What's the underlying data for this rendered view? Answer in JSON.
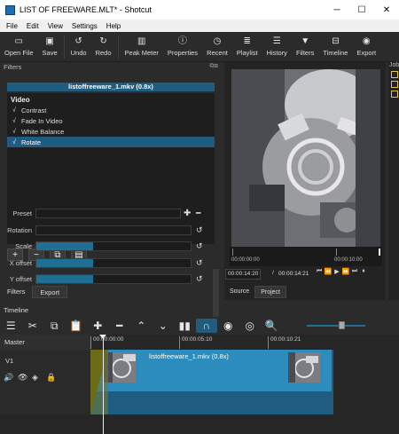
{
  "window": {
    "title": "LIST OF FREEWARE.MLT* - Shotcut",
    "minimize": "─",
    "maximize": "☐",
    "close": "✕"
  },
  "menu": [
    "File",
    "Edit",
    "View",
    "Settings",
    "Help"
  ],
  "toolbar": [
    {
      "label": "Open File",
      "icon": "folder-open-icon",
      "glyph": "▭"
    },
    {
      "label": "Save",
      "icon": "save-icon",
      "glyph": "▣"
    },
    {
      "label": "Undo",
      "icon": "undo-icon",
      "glyph": "↺"
    },
    {
      "label": "Redo",
      "icon": "redo-icon",
      "glyph": "↻"
    },
    {
      "label": "Peak Meter",
      "icon": "peak-meter-icon",
      "glyph": "▥"
    },
    {
      "label": "Properties",
      "icon": "properties-icon",
      "glyph": "ⓘ"
    },
    {
      "label": "Recent",
      "icon": "recent-icon",
      "glyph": "◷"
    },
    {
      "label": "Playlist",
      "icon": "playlist-icon",
      "glyph": "≣"
    },
    {
      "label": "History",
      "icon": "history-icon",
      "glyph": "☰"
    },
    {
      "label": "Filters",
      "icon": "filter-icon",
      "glyph": "▼"
    },
    {
      "label": "Timeline",
      "icon": "timeline-icon",
      "glyph": "⊟"
    },
    {
      "label": "Export",
      "icon": "export-icon",
      "glyph": "◉"
    }
  ],
  "filters": {
    "panel_title": "Filters",
    "clip_name": "listoffreeware_1.mkv (0.8x)",
    "section": "Video",
    "items": [
      {
        "label": "Contrast",
        "checked": "√"
      },
      {
        "label": "Fade In Video",
        "checked": "√"
      },
      {
        "label": "White Balance",
        "checked": "√"
      },
      {
        "label": "Rotate",
        "checked": "√"
      }
    ],
    "buttons": [
      "+",
      "−",
      "⧉",
      "▤"
    ],
    "params": {
      "preset": "Preset",
      "rotation": "Rotation",
      "scale": "Scale",
      "x_offset": "X offset",
      "y_offset": "Y offset"
    },
    "levels": {
      "rotation": 0,
      "scale": 0.37,
      "x_offset": 0.37,
      "y_offset": 0.37
    },
    "tabs": [
      "Filters",
      "Export"
    ]
  },
  "player": {
    "ruler": [
      "00:00:00:00",
      "00:00:10:00"
    ],
    "position": "00:00:14:20",
    "separator": "/",
    "duration": "00:00:14:21",
    "transport": [
      "⏮",
      "⏪",
      "▶",
      "⏩",
      "⏭",
      "⏸"
    ],
    "tabs": [
      "Source",
      "Project"
    ]
  },
  "jobs": {
    "title": "Job"
  },
  "timeline": {
    "panel_title": "Timeline",
    "tools": [
      "☰",
      "✂",
      "⧉",
      "📋",
      "✚",
      "━",
      "⌃",
      "⌄",
      "▮▮",
      "∩",
      "◉",
      "◎",
      "🔍"
    ],
    "master": "Master",
    "track": "V1",
    "track_icons": [
      "🔊",
      "👁",
      "◈",
      "🔒"
    ],
    "ruler": [
      "00:00:00:00",
      "00:00:05:10",
      "00:00:10:21"
    ],
    "clip_title": "listoffreeware_1.mkv (0.8x)"
  },
  "colors": {
    "accent": "#1f5c7f",
    "clip": "#2b8cbd",
    "fade": "#6b6b1a"
  }
}
